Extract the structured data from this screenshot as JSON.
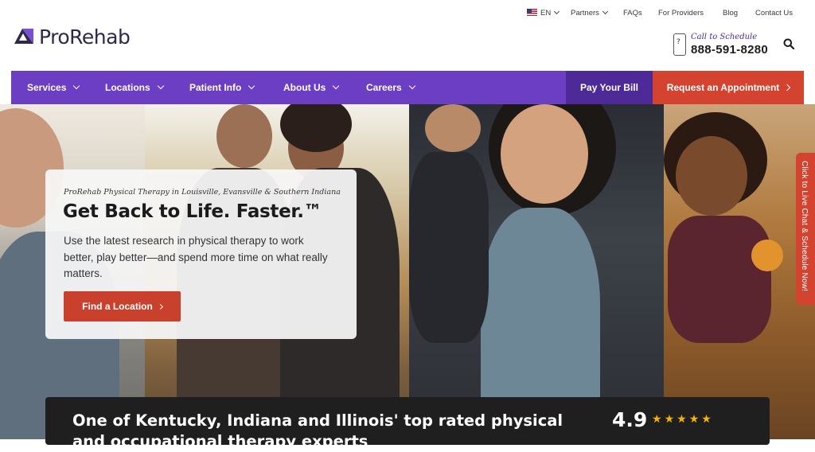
{
  "utility_nav": {
    "language": "EN",
    "partners": "Partners",
    "faqs": "FAQs",
    "for_providers": "For Providers",
    "blog": "Blog",
    "contact": "Contact Us"
  },
  "header": {
    "logo_text": "ProRehab",
    "schedule_label": "Call to Schedule",
    "phone": "888-591-8280"
  },
  "nav": {
    "items": [
      {
        "label": "Services"
      },
      {
        "label": "Locations"
      },
      {
        "label": "Patient Info"
      },
      {
        "label": "About Us"
      },
      {
        "label": "Careers"
      }
    ],
    "pay_bill": "Pay Your Bill",
    "request_appointment": "Request an Appointment"
  },
  "hero": {
    "eyebrow": "ProRehab Physical Therapy in Louisville, Evansville & Southern Indiana",
    "title": "Get Back to Life. Faster.™",
    "description": "Use the latest research in physical therapy to work better, play better—and spend more time on what really matters.",
    "cta": "Find a Location"
  },
  "chat_tab": "Click to Live Chat & Schedule Now!",
  "ratings": {
    "headline": "One of Kentucky, Indiana and Illinois' top rated physical and occupational therapy experts",
    "score": "4.9",
    "stars": 5
  },
  "colors": {
    "brand_purple": "#6c3ec4",
    "dark_purple": "#4e2a99",
    "accent_red": "#d4432f",
    "rating_bg": "#1f1f1f",
    "star": "#f4b400"
  },
  "icons": {
    "flag": "us-flag-icon",
    "phone": "phone-icon",
    "search": "search-icon",
    "chevron": "chevron-down-icon",
    "arrow": "chevron-right-icon",
    "star": "star-icon"
  }
}
